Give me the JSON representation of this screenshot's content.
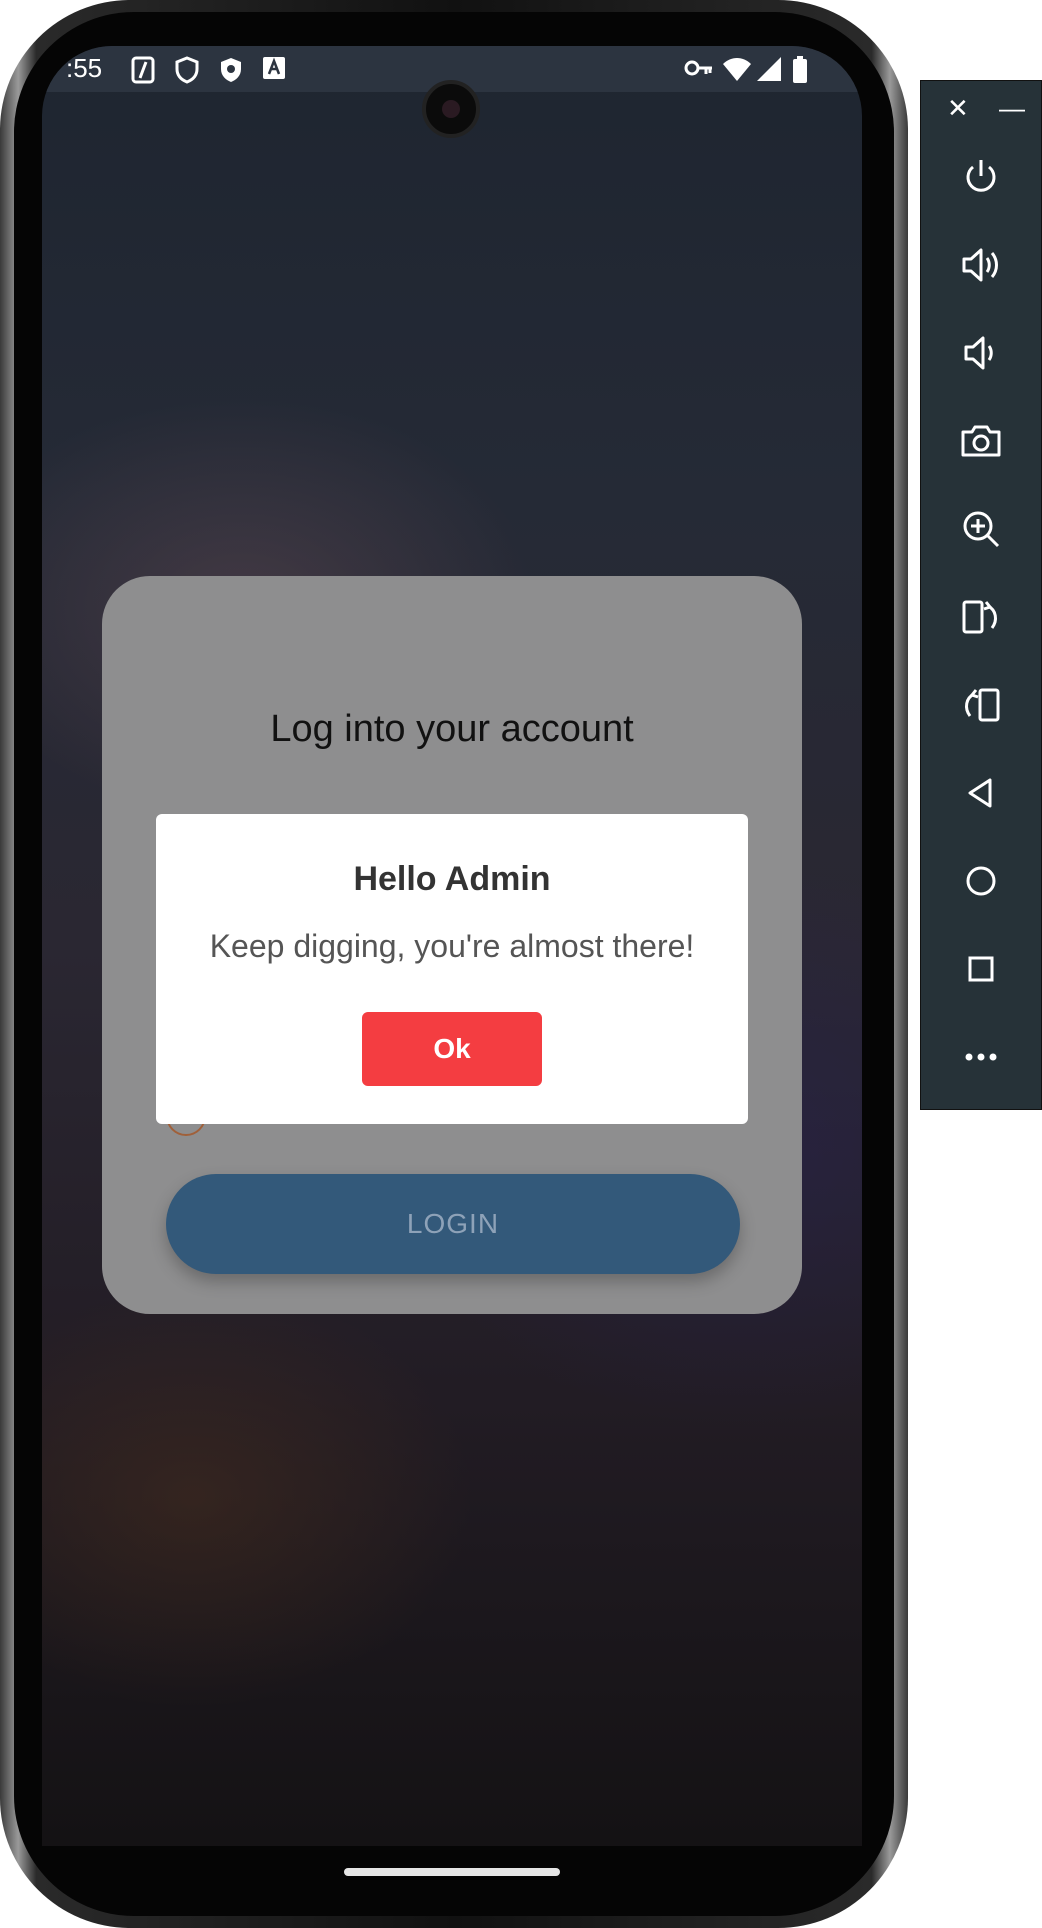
{
  "status_bar": {
    "time": ":55"
  },
  "card": {
    "title": "Log into your account",
    "login_label": "LOGIN"
  },
  "dialog": {
    "title": "Hello Admin",
    "message": "Keep digging, you're almost there!",
    "ok_label": "Ok"
  },
  "emulator_panel": {
    "close_label": "✕",
    "minimize_label": "—",
    "buttons": [
      "power-icon",
      "volume-up-icon",
      "volume-down-icon",
      "camera-icon",
      "zoom-in-icon",
      "rotate-left-icon",
      "rotate-right-icon",
      "back-icon",
      "home-icon",
      "overview-icon",
      "more-icon"
    ]
  },
  "colors": {
    "ok_button": "#f43d41",
    "login_button": "#33597a",
    "panel_bg": "#263238"
  }
}
